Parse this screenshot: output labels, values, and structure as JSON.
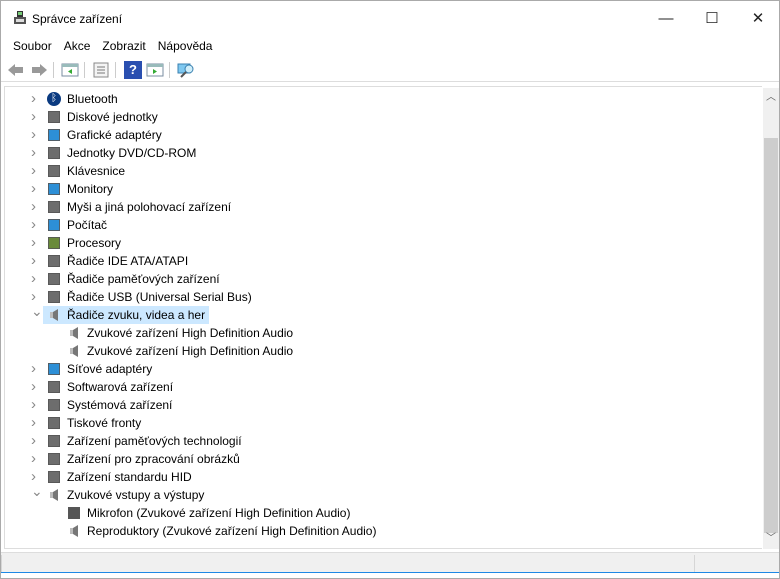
{
  "window": {
    "title": "Správce zařízení",
    "minimize": "—",
    "maximize": "☐",
    "close": "✕"
  },
  "menu": [
    "Soubor",
    "Akce",
    "Zobrazit",
    "Nápověda"
  ],
  "toolbar": {
    "help_label": "?"
  },
  "tree": [
    {
      "label": "Bluetooth",
      "icon": "bluetooth-icon",
      "level": 0,
      "expanded": false
    },
    {
      "label": "Diskové jednotky",
      "icon": "disk-drive-icon",
      "level": 0,
      "expanded": false
    },
    {
      "label": "Grafické adaptéry",
      "icon": "display-adapter-icon",
      "level": 0,
      "expanded": false
    },
    {
      "label": "Jednotky DVD/CD-ROM",
      "icon": "dvd-drive-icon",
      "level": 0,
      "expanded": false
    },
    {
      "label": "Klávesnice",
      "icon": "keyboard-icon",
      "level": 0,
      "expanded": false
    },
    {
      "label": "Monitory",
      "icon": "monitor-icon",
      "level": 0,
      "expanded": false
    },
    {
      "label": "Myši a jiná polohovací zařízení",
      "icon": "mouse-icon",
      "level": 0,
      "expanded": false
    },
    {
      "label": "Počítač",
      "icon": "computer-icon",
      "level": 0,
      "expanded": false
    },
    {
      "label": "Procesory",
      "icon": "processor-icon",
      "level": 0,
      "expanded": false
    },
    {
      "label": "Řadiče IDE ATA/ATAPI",
      "icon": "ide-controller-icon",
      "level": 0,
      "expanded": false
    },
    {
      "label": "Řadiče paměťových zařízení",
      "icon": "storage-controller-icon",
      "level": 0,
      "expanded": false
    },
    {
      "label": "Řadiče USB (Universal Serial Bus)",
      "icon": "usb-icon",
      "level": 0,
      "expanded": false
    },
    {
      "label": "Řadiče zvuku, videa a her",
      "icon": "speaker-icon",
      "level": 0,
      "expanded": true,
      "selected": true
    },
    {
      "label": "Zvukové zařízení High Definition Audio",
      "icon": "speaker-icon",
      "level": 1
    },
    {
      "label": "Zvukové zařízení High Definition Audio",
      "icon": "speaker-icon",
      "level": 1
    },
    {
      "label": "Síťové adaptéry",
      "icon": "network-adapter-icon",
      "level": 0,
      "expanded": false
    },
    {
      "label": "Softwarová zařízení",
      "icon": "software-device-icon",
      "level": 0,
      "expanded": false
    },
    {
      "label": "Systémová zařízení",
      "icon": "system-device-icon",
      "level": 0,
      "expanded": false
    },
    {
      "label": "Tiskové fronty",
      "icon": "printer-icon",
      "level": 0,
      "expanded": false
    },
    {
      "label": "Zařízení paměťových technologií",
      "icon": "memory-tech-icon",
      "level": 0,
      "expanded": false
    },
    {
      "label": "Zařízení pro zpracování obrázků",
      "icon": "imaging-device-icon",
      "level": 0,
      "expanded": false
    },
    {
      "label": "Zařízení standardu HID",
      "icon": "hid-icon",
      "level": 0,
      "expanded": false
    },
    {
      "label": "Zvukové vstupy a výstupy",
      "icon": "audio-io-icon",
      "level": 0,
      "expanded": true
    },
    {
      "label": "Mikrofon (Zvukové zařízení High Definition Audio)",
      "icon": "microphone-icon",
      "level": 1
    },
    {
      "label": "Reproduktory (Zvukové zařízení High Definition Audio)",
      "icon": "speaker-icon",
      "level": 1
    }
  ],
  "colors": {
    "selection": "#cce8ff",
    "accent": "#1e88e5"
  }
}
